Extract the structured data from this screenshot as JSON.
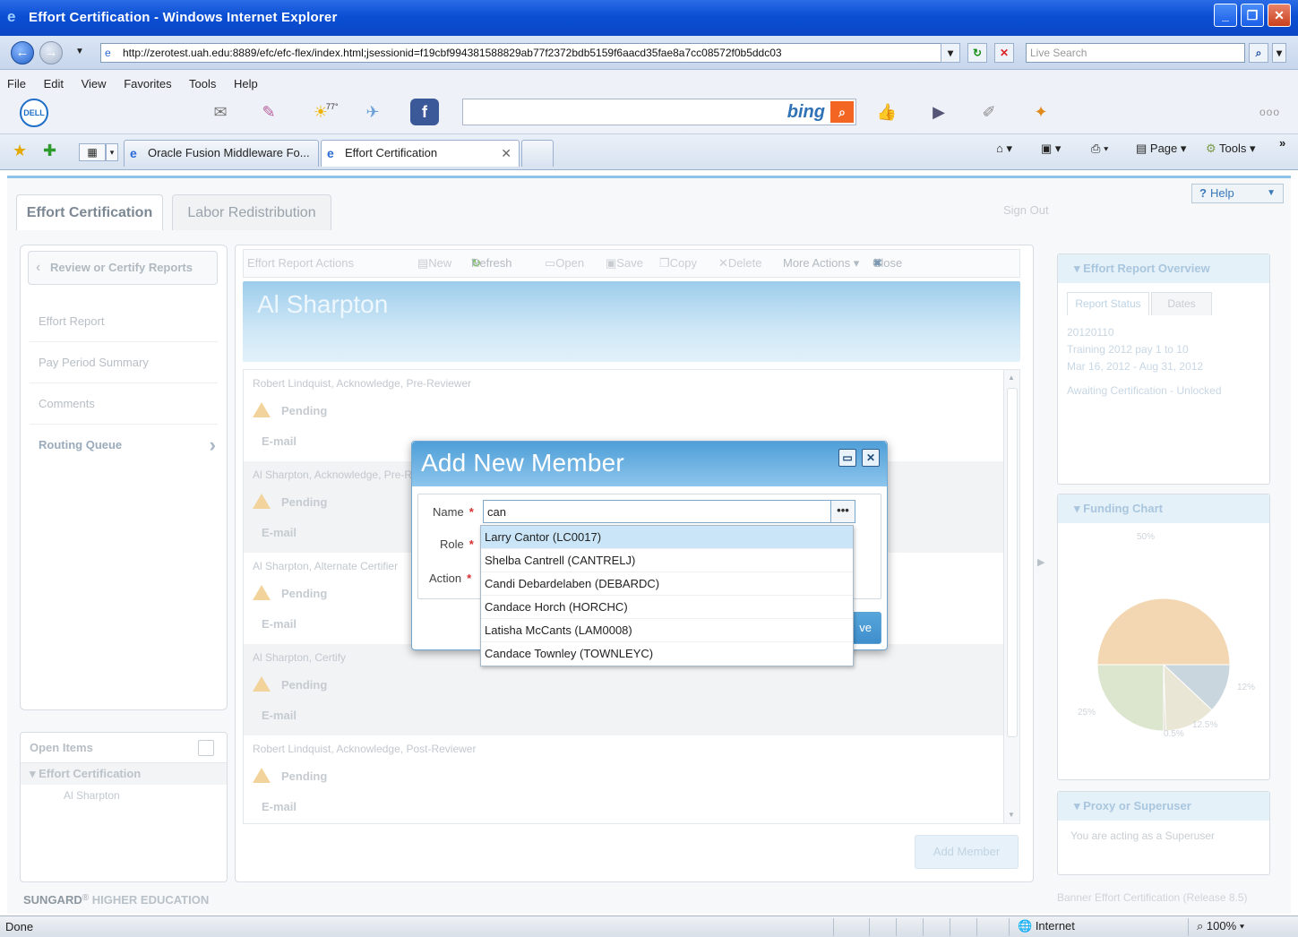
{
  "window": {
    "title": "Effort Certification - Windows Internet Explorer"
  },
  "address": {
    "url": "http://zerotest.uah.edu:8889/efc/efc-flex/index.html;jsessionid=f19cbf994381588829ab77f2372bdb5159f6aacd35fae8a7cc08572f0b5ddc03",
    "search_placeholder": "Live Search"
  },
  "menu": [
    "File",
    "Edit",
    "View",
    "Favorites",
    "Tools",
    "Help"
  ],
  "toolbar": {
    "weather_temp": "77°",
    "bing_label": "bing",
    "overflow": "ooo"
  },
  "tabs": [
    {
      "label": "Oracle Fusion Middleware Fo..."
    },
    {
      "label": "Effort Certification"
    }
  ],
  "commands": {
    "page": "Page",
    "tools": "Tools",
    "chevron": "»"
  },
  "app": {
    "tabs": [
      "Effort Certification",
      "Labor Redistribution"
    ],
    "sign_out": "Sign Out",
    "help": "Help",
    "left_nav": {
      "review_button": "Review or Certify Reports",
      "items": [
        "Effort Report",
        "Pay Period Summary",
        "Comments",
        "Routing Queue"
      ]
    },
    "open_items": {
      "title": "Open Items",
      "group": "Effort Certification",
      "leaf": "Al Sharpton"
    },
    "actions": {
      "title": "Effort Report Actions",
      "new": "New",
      "refresh": "Refresh",
      "open": "Open",
      "save": "Save",
      "copy": "Copy",
      "delete": "Delete",
      "more": "More Actions ▾",
      "close": "Close"
    },
    "person_name": "Al Sharpton",
    "queue": [
      {
        "who": "Robert Lindquist, Acknowledge, Pre-Reviewer",
        "status": "Pending",
        "email": "E-mail"
      },
      {
        "who": "Al Sharpton, Acknowledge, Pre-R",
        "status": "Pending",
        "email": "E-mail"
      },
      {
        "who": "Al Sharpton, Alternate Certifier",
        "status": "Pending",
        "email": "E-mail"
      },
      {
        "who": "Al Sharpton, Certify",
        "status": "Pending",
        "email": "E-mail"
      },
      {
        "who": "Robert Lindquist, Acknowledge, Post-Reviewer",
        "status": "Pending",
        "email": "E-mail"
      }
    ],
    "add_member_button": "Add Member",
    "overview": {
      "title": "Effort Report Overview",
      "tabs": [
        "Report Status",
        "Dates"
      ],
      "id": "20120110",
      "desc": "Training 2012 pay 1 to 10",
      "range": "Mar 16, 2012 - Aug 31, 2012",
      "status": "Awaiting Certification - Unlocked"
    },
    "funding": {
      "title": "Funding Chart"
    },
    "proxy": {
      "title": "Proxy or Superuser",
      "text": "You are acting as a Superuser"
    },
    "footer_left_brand": "SUNGARD",
    "footer_left_rest": "HIGHER EDUCATION",
    "footer_right": "Banner Effort Certification (Release 8.5)"
  },
  "modal": {
    "title": "Add New Member",
    "name_label": "Name",
    "role_label": "Role",
    "action_label": "Action",
    "name_value": "can",
    "lookup": "•••",
    "save_fragment": "ve",
    "options": [
      "Larry Cantor (LC0017)",
      "Shelba Cantrell (CANTRELJ)",
      "Candi Debardelaben (DEBARDC)",
      "Candace Horch (HORCHC)",
      "Latisha McCants (LAM0008)",
      "Candace Townley (TOWNLEYC)"
    ]
  },
  "chart_data": {
    "type": "pie",
    "title": "",
    "slices": [
      {
        "label": "50%",
        "value": 50,
        "color": "#f3d7b2"
      },
      {
        "label": "12%",
        "value": 12,
        "color": "#c9d6de"
      },
      {
        "label": "12.5%",
        "value": 12.5,
        "color": "#e9e6d6"
      },
      {
        "label": "0.5%",
        "value": 0.5,
        "color": "#d9d4c4"
      },
      {
        "label": "25%",
        "value": 25,
        "color": "#dce6cf"
      }
    ]
  },
  "statusbar": {
    "done": "Done",
    "zone": "Internet",
    "zoom": "100%"
  }
}
